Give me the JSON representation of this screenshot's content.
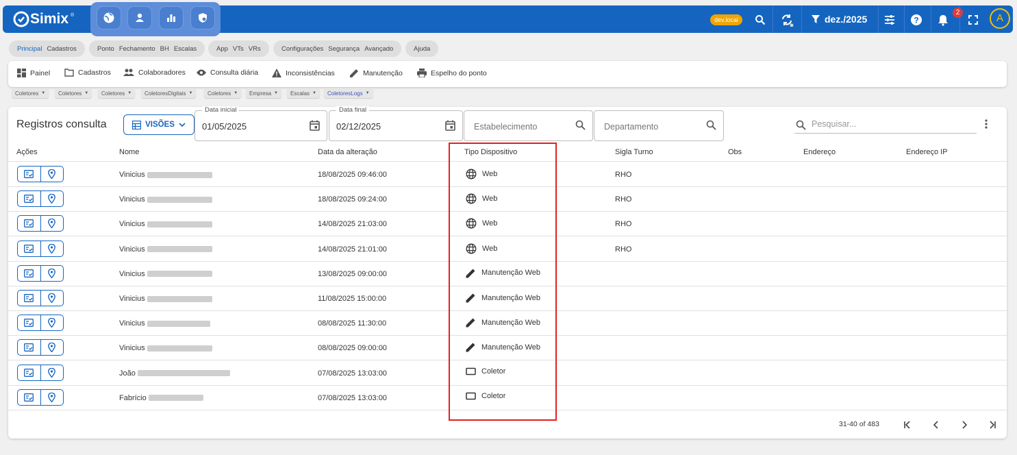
{
  "app": {
    "brand": "Simix",
    "trademark": "®",
    "mode_buttons": [
      "globe-icon",
      "person-icon",
      "bar-chart-icon",
      "shield-icon"
    ],
    "env_badge": "dev.local",
    "period": "dez./2025",
    "notifications_count": "2",
    "avatar_initial": "A",
    "colors": {
      "primary": "#1565c0",
      "accent": "#f0a500",
      "badge": "#e53935",
      "highlight": "#e02020"
    }
  },
  "menu_groups": [
    {
      "items": [
        "Principal",
        "Cadastros"
      ]
    },
    {
      "items": [
        "Ponto",
        "Fechamento",
        "BH",
        "Escalas"
      ]
    },
    {
      "items": [
        "App",
        "VTs",
        "VRs"
      ]
    },
    {
      "items": [
        "Configurações",
        "Segurança",
        "Avançado"
      ]
    },
    {
      "items": [
        "Ajuda"
      ]
    }
  ],
  "nav": [
    "Painel",
    "Cadastros",
    "Colaboradores",
    "Consulta diária",
    "Inconsistências",
    "Manutenção",
    "Espelho do ponto"
  ],
  "subtabs": [
    "Coletores",
    "Coletores",
    "Coletores",
    "ColetoresDigitais",
    "Coletores",
    "Empresa",
    "Escalas",
    "ColetoresLogs"
  ],
  "main": {
    "title": "Registros consulta",
    "views_button": "VISÕES",
    "date_start": {
      "label": "Data inicial",
      "value": "01/05/2025"
    },
    "date_end": {
      "label": "Data final",
      "value": "02/12/2025"
    },
    "establishment_placeholder": "Estabelecimento",
    "department_placeholder": "Departamento",
    "search_placeholder": "Pesquisar..."
  },
  "table": {
    "columns": [
      "Ações",
      "Nome",
      "Data da alteração",
      "Tipo Dispositivo",
      "Sigla Turno",
      "Obs",
      "Endereço",
      "Endereço IP"
    ],
    "rows": [
      {
        "name": "Vinicius",
        "date": "18/08/2025 09:46:00",
        "device": "Web",
        "device_icon": "globe-icon",
        "shift": "RHO"
      },
      {
        "name": "Vinicius",
        "date": "18/08/2025 09:24:00",
        "device": "Web",
        "device_icon": "globe-icon",
        "shift": "RHO"
      },
      {
        "name": "Vinicius",
        "date": "14/08/2025 21:03:00",
        "device": "Web",
        "device_icon": "globe-icon",
        "shift": "RHO"
      },
      {
        "name": "Vinicius",
        "date": "14/08/2025 21:01:00",
        "device": "Web",
        "device_icon": "globe-icon",
        "shift": "RHO"
      },
      {
        "name": "Vinicius",
        "date": "13/08/2025 09:00:00",
        "device": "Manutenção Web",
        "device_icon": "pencil-icon",
        "shift": ""
      },
      {
        "name": "Vinicius",
        "date": "11/08/2025 15:00:00",
        "device": "Manutenção Web",
        "device_icon": "pencil-icon",
        "shift": ""
      },
      {
        "name": "Vinicius",
        "date": "08/08/2025 11:30:00",
        "device": "Manutenção Web",
        "device_icon": "pencil-icon",
        "shift": ""
      },
      {
        "name": "Vinicius",
        "date": "08/08/2025 09:00:00",
        "device": "Manutenção Web",
        "device_icon": "pencil-icon",
        "shift": ""
      },
      {
        "name": "João",
        "date": "07/08/2025 13:03:00",
        "device": "Coletor",
        "device_icon": "device-icon",
        "shift": ""
      },
      {
        "name": "Fabrício",
        "date": "07/08/2025 13:03:00",
        "device": "Coletor",
        "device_icon": "device-icon",
        "shift": ""
      }
    ]
  },
  "pagination": {
    "range": "31-40 of 483"
  }
}
